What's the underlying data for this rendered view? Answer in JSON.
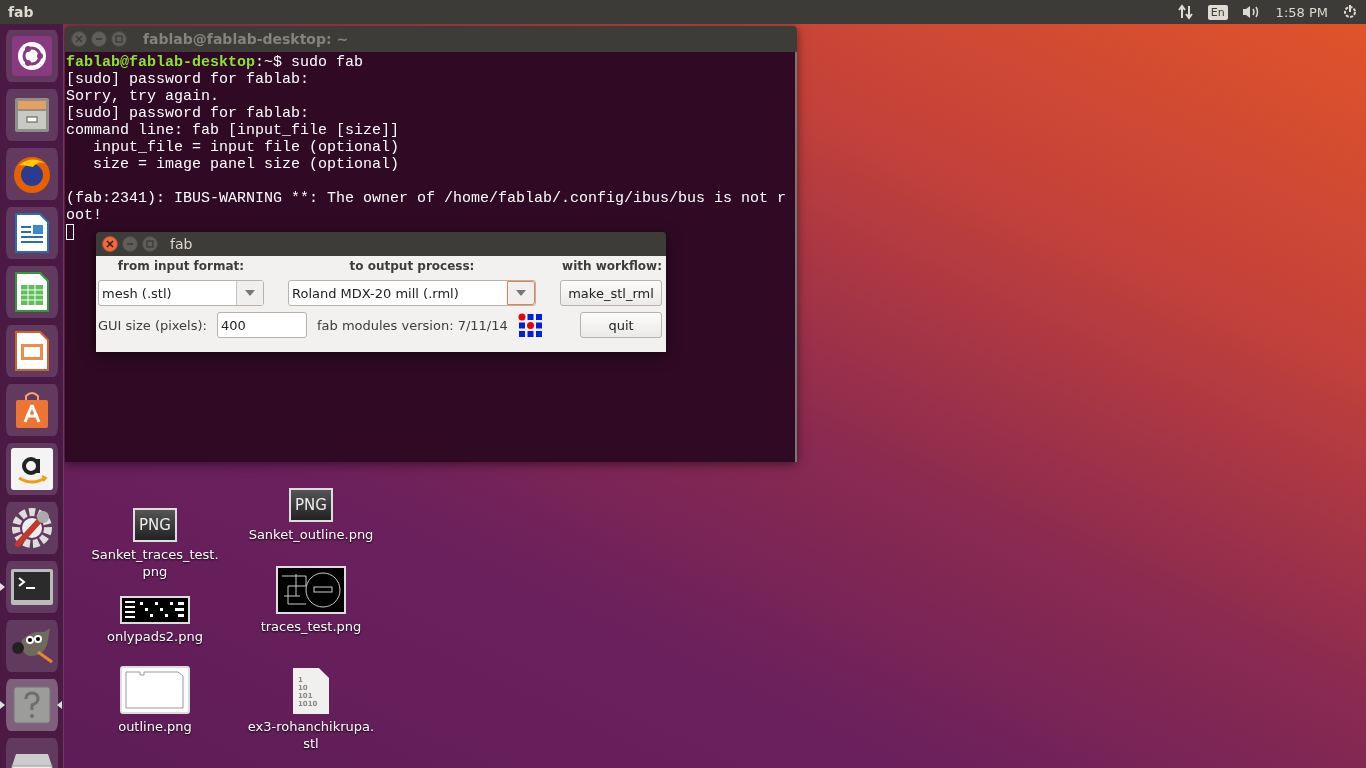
{
  "top_panel": {
    "app_title": "fab",
    "keyboard_layout": "En",
    "clock": "1:58 PM"
  },
  "launcher": {
    "items": [
      {
        "kind": "ubuntu",
        "running": false,
        "focused": false
      },
      {
        "kind": "files",
        "running": false,
        "focused": false
      },
      {
        "kind": "firefox",
        "running": false,
        "focused": false
      },
      {
        "kind": "writer",
        "running": false,
        "focused": false
      },
      {
        "kind": "calc",
        "running": false,
        "focused": false
      },
      {
        "kind": "impress",
        "running": false,
        "focused": false
      },
      {
        "kind": "software",
        "running": false,
        "focused": false
      },
      {
        "kind": "amazon",
        "running": false,
        "focused": false
      },
      {
        "kind": "settings",
        "running": false,
        "focused": false
      },
      {
        "kind": "terminal",
        "running": true,
        "focused": false
      },
      {
        "kind": "gimp",
        "running": false,
        "focused": false
      },
      {
        "kind": "help",
        "running": true,
        "focused": true
      },
      {
        "kind": "drive",
        "running": false,
        "focused": false
      }
    ]
  },
  "terminal": {
    "title": "fablab@fablab-desktop: ~",
    "focused": false,
    "lines": [
      {
        "kind": "text",
        "segments": [
          {
            "kind": "prompt",
            "text": "fablab@fablab-desktop"
          },
          {
            "kind": "plain",
            "text": ":~$ sudo fab"
          }
        ]
      },
      {
        "kind": "text",
        "segments": [
          {
            "kind": "plain",
            "text": "[sudo] password for fablab:"
          }
        ]
      },
      {
        "kind": "text",
        "segments": [
          {
            "kind": "plain",
            "text": "Sorry, try again."
          }
        ]
      },
      {
        "kind": "text",
        "segments": [
          {
            "kind": "plain",
            "text": "[sudo] password for fablab:"
          }
        ]
      },
      {
        "kind": "text",
        "segments": [
          {
            "kind": "plain",
            "text": "command line: fab [input_file [size]]"
          }
        ]
      },
      {
        "kind": "text",
        "segments": [
          {
            "kind": "plain",
            "text": "   input_file = input file (optional)"
          }
        ]
      },
      {
        "kind": "text",
        "segments": [
          {
            "kind": "plain",
            "text": "   size = image panel size (optional)"
          }
        ]
      },
      {
        "kind": "blank"
      },
      {
        "kind": "text",
        "segments": [
          {
            "kind": "plain",
            "text": "(fab:2341): IBUS-WARNING **: The owner of /home/fablab/.config/ibus/bus is not r"
          }
        ]
      },
      {
        "kind": "text",
        "segments": [
          {
            "kind": "plain",
            "text": "oot!"
          }
        ]
      },
      {
        "kind": "cursor"
      }
    ]
  },
  "fab_dialog": {
    "title": "fab",
    "focused": true,
    "headings": [
      "from input format:",
      "to output process:",
      "with workflow:"
    ],
    "input_format": {
      "value": "mesh (.stl)",
      "focused": false
    },
    "output_process": {
      "value": "Roland MDX-20 mill (.rml)",
      "focused": true
    },
    "workflow_button": "make_stl_rml",
    "gui_size_label": "GUI size (pixels):",
    "gui_size_value": "400",
    "version": "fab modules version: 7/11/14",
    "quit_button": "quit"
  },
  "desktop_icons": [
    {
      "kind": "png-badge",
      "badge_text": "PNG",
      "label_lines": [
        "Sanket_traces_test.",
        "png"
      ]
    },
    {
      "kind": "pads-thumb",
      "label_lines": [
        "onlypads2.png"
      ]
    },
    {
      "kind": "outline-thumb",
      "label_lines": [
        "outline.png"
      ]
    },
    {
      "kind": "png-badge",
      "badge_text": "PNG",
      "label_lines": [
        "Sanket_outline.png"
      ]
    },
    {
      "kind": "pcb-thumb",
      "label_lines": [
        "traces_test.png"
      ]
    },
    {
      "kind": "text-file",
      "preview_lines": [
        "1",
        "10",
        "101",
        "1010"
      ],
      "label_lines": [
        "ex3-rohanchikrupa.",
        "stl"
      ]
    }
  ]
}
